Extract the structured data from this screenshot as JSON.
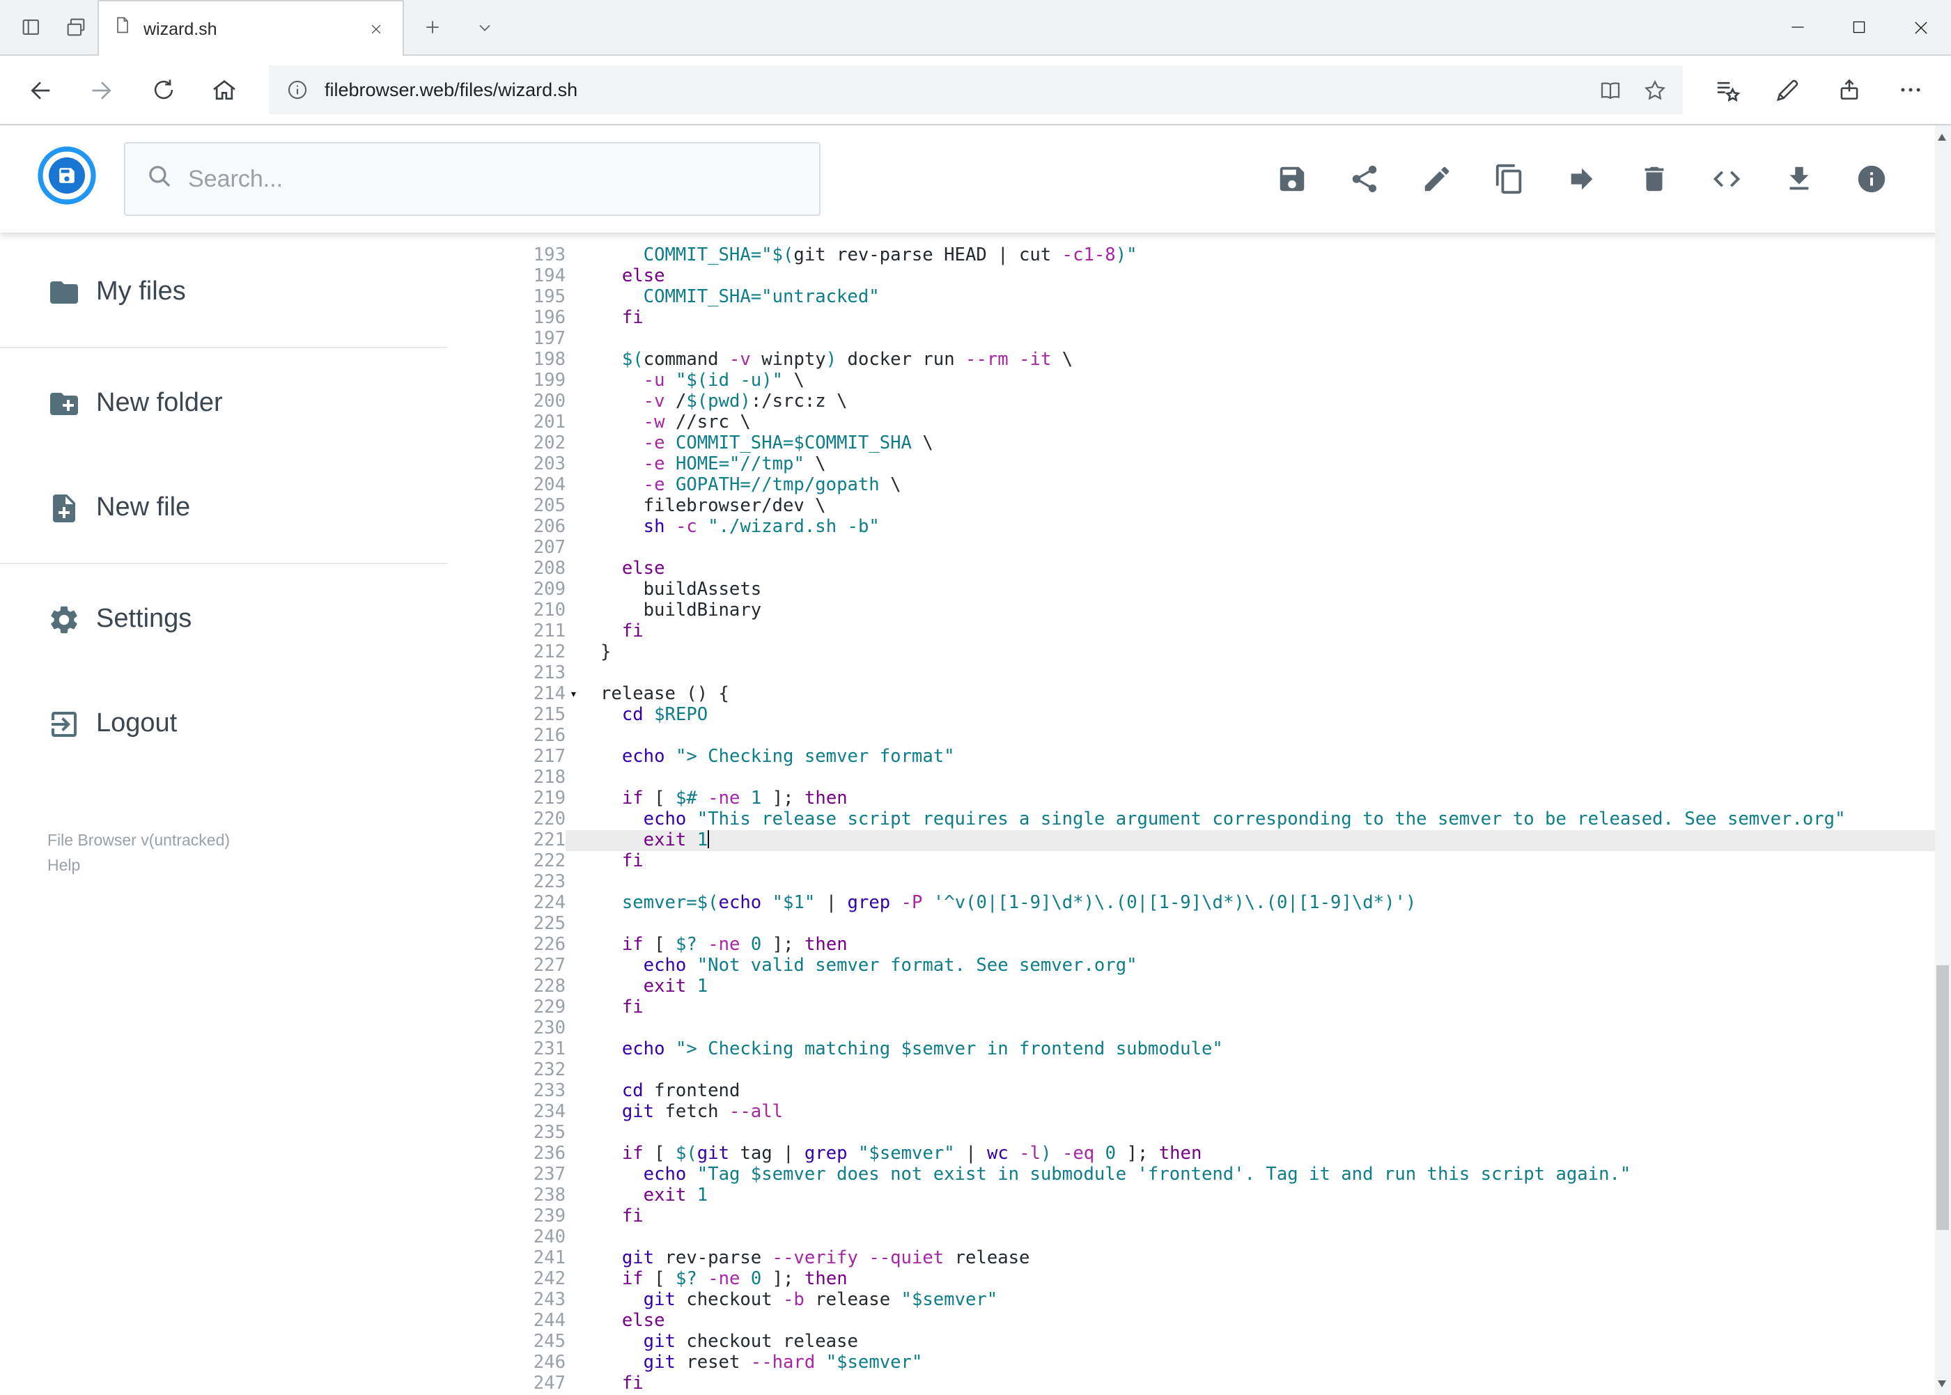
{
  "browser": {
    "tab_title": "wizard.sh",
    "url_domain": "filebrowser.web",
    "url_path": "/files/wizard.sh"
  },
  "header": {
    "search_placeholder": "Search...",
    "logo_color": "#2196f3",
    "toolbar": [
      {
        "id": "save",
        "icon": "save"
      },
      {
        "id": "share",
        "icon": "share"
      },
      {
        "id": "rename",
        "icon": "edit"
      },
      {
        "id": "copy",
        "icon": "copy"
      },
      {
        "id": "move",
        "icon": "move"
      },
      {
        "id": "delete",
        "icon": "trash"
      },
      {
        "id": "raw-code",
        "icon": "code"
      },
      {
        "id": "download",
        "icon": "download"
      },
      {
        "id": "info",
        "icon": "info"
      }
    ]
  },
  "sidebar": {
    "items": [
      {
        "id": "my-files",
        "label": "My files",
        "icon": "folder",
        "divider_after": true
      },
      {
        "id": "new-folder",
        "label": "New folder",
        "icon": "folder-plus",
        "divider_after": false
      },
      {
        "id": "new-file",
        "label": "New file",
        "icon": "file-plus",
        "divider_after": true
      },
      {
        "id": "settings",
        "label": "Settings",
        "icon": "gear",
        "divider_after": false
      },
      {
        "id": "logout",
        "label": "Logout",
        "icon": "logout",
        "divider_after": false
      }
    ],
    "footer": {
      "version": "File Browser v(untracked)",
      "help": "Help"
    }
  },
  "editor": {
    "active_line": 221,
    "fold_marker": "▾",
    "colors": {
      "p": "#24292e",
      "k": "#770088",
      "b": "#3300aa",
      "t": "#0e7d8a",
      "f": "#a626a4",
      "ln": "#9aa0a6",
      "active_bg": "#ececec"
    },
    "lines": [
      {
        "n": 193,
        "t": [
          [
            "p",
            "    "
          ],
          [
            "t",
            "COMMIT_SHA=\"$("
          ],
          [
            "p",
            "git rev-parse HEAD | cut "
          ],
          [
            "f",
            "-c1-8"
          ],
          [
            "t",
            ")\""
          ]
        ]
      },
      {
        "n": 194,
        "t": [
          [
            "p",
            "  "
          ],
          [
            "k",
            "else"
          ]
        ]
      },
      {
        "n": 195,
        "t": [
          [
            "p",
            "    "
          ],
          [
            "t",
            "COMMIT_SHA="
          ],
          [
            "t",
            "\"untracked\""
          ]
        ]
      },
      {
        "n": 196,
        "t": [
          [
            "p",
            "  "
          ],
          [
            "k",
            "fi"
          ]
        ]
      },
      {
        "n": 197,
        "t": []
      },
      {
        "n": 198,
        "t": [
          [
            "p",
            "  "
          ],
          [
            "t",
            "$("
          ],
          [
            "p",
            "command "
          ],
          [
            "f",
            "-v"
          ],
          [
            "p",
            " winpty"
          ],
          [
            "t",
            ")"
          ],
          [
            "p",
            " docker run "
          ],
          [
            "f",
            "--rm"
          ],
          [
            "p",
            " "
          ],
          [
            "f",
            "-it"
          ],
          [
            "p",
            " \\"
          ]
        ]
      },
      {
        "n": 199,
        "t": [
          [
            "p",
            "    "
          ],
          [
            "f",
            "-u"
          ],
          [
            "p",
            " "
          ],
          [
            "t",
            "\"$(id -u)\""
          ],
          [
            "p",
            " \\"
          ]
        ]
      },
      {
        "n": 200,
        "t": [
          [
            "p",
            "    "
          ],
          [
            "f",
            "-v"
          ],
          [
            "p",
            " /"
          ],
          [
            "t",
            "$(pwd)"
          ],
          [
            "p",
            ":/src:z \\"
          ]
        ]
      },
      {
        "n": 201,
        "t": [
          [
            "p",
            "    "
          ],
          [
            "f",
            "-w"
          ],
          [
            "p",
            " //src \\"
          ]
        ]
      },
      {
        "n": 202,
        "t": [
          [
            "p",
            "    "
          ],
          [
            "f",
            "-e"
          ],
          [
            "p",
            " "
          ],
          [
            "t",
            "COMMIT_SHA=$COMMIT_SHA"
          ],
          [
            "p",
            " \\"
          ]
        ]
      },
      {
        "n": 203,
        "t": [
          [
            "p",
            "    "
          ],
          [
            "f",
            "-e"
          ],
          [
            "p",
            " "
          ],
          [
            "t",
            "HOME="
          ],
          [
            "t",
            "\"//tmp\""
          ],
          [
            "p",
            " \\"
          ]
        ]
      },
      {
        "n": 204,
        "t": [
          [
            "p",
            "    "
          ],
          [
            "f",
            "-e"
          ],
          [
            "p",
            " "
          ],
          [
            "t",
            "GOPATH=//tmp/gopath"
          ],
          [
            "p",
            " \\"
          ]
        ]
      },
      {
        "n": 205,
        "t": [
          [
            "p",
            "    filebrowser/dev \\"
          ]
        ]
      },
      {
        "n": 206,
        "t": [
          [
            "p",
            "    "
          ],
          [
            "b",
            "sh"
          ],
          [
            "p",
            " "
          ],
          [
            "f",
            "-c"
          ],
          [
            "p",
            " "
          ],
          [
            "t",
            "\"./wizard.sh -b\""
          ]
        ]
      },
      {
        "n": 207,
        "t": []
      },
      {
        "n": 208,
        "t": [
          [
            "p",
            "  "
          ],
          [
            "k",
            "else"
          ]
        ]
      },
      {
        "n": 209,
        "t": [
          [
            "p",
            "    buildAssets"
          ]
        ]
      },
      {
        "n": 210,
        "t": [
          [
            "p",
            "    buildBinary"
          ]
        ]
      },
      {
        "n": 211,
        "t": [
          [
            "p",
            "  "
          ],
          [
            "k",
            "fi"
          ]
        ]
      },
      {
        "n": 212,
        "t": [
          [
            "p",
            "}"
          ]
        ]
      },
      {
        "n": 213,
        "t": []
      },
      {
        "n": 214,
        "fold": true,
        "t": [
          [
            "p",
            "release () {"
          ]
        ]
      },
      {
        "n": 215,
        "t": [
          [
            "p",
            "  "
          ],
          [
            "b",
            "cd"
          ],
          [
            "p",
            " "
          ],
          [
            "t",
            "$REPO"
          ]
        ]
      },
      {
        "n": 216,
        "t": []
      },
      {
        "n": 217,
        "t": [
          [
            "p",
            "  "
          ],
          [
            "b",
            "echo"
          ],
          [
            "p",
            " "
          ],
          [
            "t",
            "\"> Checking semver format\""
          ]
        ]
      },
      {
        "n": 218,
        "t": []
      },
      {
        "n": 219,
        "t": [
          [
            "p",
            "  "
          ],
          [
            "k",
            "if"
          ],
          [
            "p",
            " [ "
          ],
          [
            "t",
            "$#"
          ],
          [
            "p",
            " "
          ],
          [
            "f",
            "-ne"
          ],
          [
            "p",
            " "
          ],
          [
            "t",
            "1"
          ],
          [
            "p",
            " ]; "
          ],
          [
            "k",
            "then"
          ]
        ]
      },
      {
        "n": 220,
        "t": [
          [
            "p",
            "    "
          ],
          [
            "b",
            "echo"
          ],
          [
            "p",
            " "
          ],
          [
            "t",
            "\"This release script requires a single argument corresponding to the semver to be released. See semver.org\""
          ]
        ]
      },
      {
        "n": 221,
        "cursor": true,
        "t": [
          [
            "p",
            "    "
          ],
          [
            "k",
            "exit"
          ],
          [
            "p",
            " "
          ],
          [
            "t",
            "1"
          ]
        ]
      },
      {
        "n": 222,
        "t": [
          [
            "p",
            "  "
          ],
          [
            "k",
            "fi"
          ]
        ]
      },
      {
        "n": 223,
        "t": []
      },
      {
        "n": 224,
        "t": [
          [
            "p",
            "  "
          ],
          [
            "t",
            "semver=$("
          ],
          [
            "b",
            "echo"
          ],
          [
            "p",
            " "
          ],
          [
            "t",
            "\"$1\""
          ],
          [
            "p",
            " | "
          ],
          [
            "b",
            "grep"
          ],
          [
            "p",
            " "
          ],
          [
            "f",
            "-P"
          ],
          [
            "p",
            " "
          ],
          [
            "t",
            "'^v(0|[1-9]\\d*)\\.(0|[1-9]\\d*)\\.(0|[1-9]\\d*)'"
          ],
          [
            "t",
            ")"
          ]
        ]
      },
      {
        "n": 225,
        "t": []
      },
      {
        "n": 226,
        "t": [
          [
            "p",
            "  "
          ],
          [
            "k",
            "if"
          ],
          [
            "p",
            " [ "
          ],
          [
            "t",
            "$?"
          ],
          [
            "p",
            " "
          ],
          [
            "f",
            "-ne"
          ],
          [
            "p",
            " "
          ],
          [
            "t",
            "0"
          ],
          [
            "p",
            " ]; "
          ],
          [
            "k",
            "then"
          ]
        ]
      },
      {
        "n": 227,
        "t": [
          [
            "p",
            "    "
          ],
          [
            "b",
            "echo"
          ],
          [
            "p",
            " "
          ],
          [
            "t",
            "\"Not valid semver format. See semver.org\""
          ]
        ]
      },
      {
        "n": 228,
        "t": [
          [
            "p",
            "    "
          ],
          [
            "k",
            "exit"
          ],
          [
            "p",
            " "
          ],
          [
            "t",
            "1"
          ]
        ]
      },
      {
        "n": 229,
        "t": [
          [
            "p",
            "  "
          ],
          [
            "k",
            "fi"
          ]
        ]
      },
      {
        "n": 230,
        "t": []
      },
      {
        "n": 231,
        "t": [
          [
            "p",
            "  "
          ],
          [
            "b",
            "echo"
          ],
          [
            "p",
            " "
          ],
          [
            "t",
            "\"> Checking matching $semver in frontend submodule\""
          ]
        ]
      },
      {
        "n": 232,
        "t": []
      },
      {
        "n": 233,
        "t": [
          [
            "p",
            "  "
          ],
          [
            "b",
            "cd"
          ],
          [
            "p",
            " frontend"
          ]
        ]
      },
      {
        "n": 234,
        "t": [
          [
            "p",
            "  "
          ],
          [
            "b",
            "git"
          ],
          [
            "p",
            " fetch "
          ],
          [
            "f",
            "--all"
          ]
        ]
      },
      {
        "n": 235,
        "t": []
      },
      {
        "n": 236,
        "t": [
          [
            "p",
            "  "
          ],
          [
            "k",
            "if"
          ],
          [
            "p",
            " [ "
          ],
          [
            "t",
            "$("
          ],
          [
            "b",
            "git"
          ],
          [
            "p",
            " tag | "
          ],
          [
            "b",
            "grep"
          ],
          [
            "p",
            " "
          ],
          [
            "t",
            "\"$semver\""
          ],
          [
            "p",
            " | "
          ],
          [
            "b",
            "wc"
          ],
          [
            "p",
            " "
          ],
          [
            "f",
            "-l"
          ],
          [
            "t",
            ")"
          ],
          [
            "p",
            " "
          ],
          [
            "f",
            "-eq"
          ],
          [
            "p",
            " "
          ],
          [
            "t",
            "0"
          ],
          [
            "p",
            " ]; "
          ],
          [
            "k",
            "then"
          ]
        ]
      },
      {
        "n": 237,
        "t": [
          [
            "p",
            "    "
          ],
          [
            "b",
            "echo"
          ],
          [
            "p",
            " "
          ],
          [
            "t",
            "\"Tag $semver does not exist in submodule 'frontend'. Tag it and run this script again.\""
          ]
        ]
      },
      {
        "n": 238,
        "t": [
          [
            "p",
            "    "
          ],
          [
            "k",
            "exit"
          ],
          [
            "p",
            " "
          ],
          [
            "t",
            "1"
          ]
        ]
      },
      {
        "n": 239,
        "t": [
          [
            "p",
            "  "
          ],
          [
            "k",
            "fi"
          ]
        ]
      },
      {
        "n": 240,
        "t": []
      },
      {
        "n": 241,
        "t": [
          [
            "p",
            "  "
          ],
          [
            "b",
            "git"
          ],
          [
            "p",
            " rev-parse "
          ],
          [
            "f",
            "--verify"
          ],
          [
            "p",
            " "
          ],
          [
            "f",
            "--quiet"
          ],
          [
            "p",
            " release"
          ]
        ]
      },
      {
        "n": 242,
        "t": [
          [
            "p",
            "  "
          ],
          [
            "k",
            "if"
          ],
          [
            "p",
            " [ "
          ],
          [
            "t",
            "$?"
          ],
          [
            "p",
            " "
          ],
          [
            "f",
            "-ne"
          ],
          [
            "p",
            " "
          ],
          [
            "t",
            "0"
          ],
          [
            "p",
            " ]; "
          ],
          [
            "k",
            "then"
          ]
        ]
      },
      {
        "n": 243,
        "t": [
          [
            "p",
            "    "
          ],
          [
            "b",
            "git"
          ],
          [
            "p",
            " checkout "
          ],
          [
            "f",
            "-b"
          ],
          [
            "p",
            " release "
          ],
          [
            "t",
            "\"$semver\""
          ]
        ]
      },
      {
        "n": 244,
        "t": [
          [
            "p",
            "  "
          ],
          [
            "k",
            "else"
          ]
        ]
      },
      {
        "n": 245,
        "t": [
          [
            "p",
            "    "
          ],
          [
            "b",
            "git"
          ],
          [
            "p",
            " checkout release"
          ]
        ]
      },
      {
        "n": 246,
        "t": [
          [
            "p",
            "    "
          ],
          [
            "b",
            "git"
          ],
          [
            "p",
            " reset "
          ],
          [
            "f",
            "--hard"
          ],
          [
            "p",
            " "
          ],
          [
            "t",
            "\"$semver\""
          ]
        ]
      },
      {
        "n": 247,
        "t": [
          [
            "p",
            "  "
          ],
          [
            "k",
            "fi"
          ]
        ]
      }
    ]
  }
}
